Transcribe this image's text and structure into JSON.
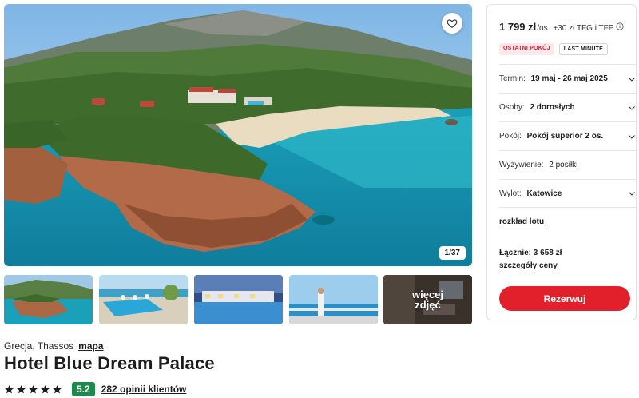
{
  "gallery": {
    "counter": "1/37",
    "favorite_icon": "heart-icon",
    "more_photos_label_line1": "więcej",
    "more_photos_label_line2": "zdjęć"
  },
  "hotel": {
    "location": "Grecja, Thassos",
    "map_link": "mapa",
    "name": "Hotel Blue Dream Palace",
    "stars": 5,
    "rating": "5.2",
    "reviews_link": "282 opinii klientów"
  },
  "booking": {
    "price": "1 799 zł",
    "per_person": "/os.",
    "extra_fees": "+30 zł TFG i TFP",
    "info_icon": "info-icon",
    "badges": [
      "OSTATNI POKÓJ",
      "LAST MINUTE"
    ],
    "rows": [
      {
        "label": "Termin:",
        "value": "19 maj - 26 maj 2025",
        "chevron": true
      },
      {
        "label": "Osoby:",
        "value": "2 dorosłych",
        "chevron": true
      },
      {
        "label": "Pokój:",
        "value": "Pokój superior 2 os.",
        "chevron": true
      },
      {
        "label": "Wyżywienie:",
        "value": "2 posiłki",
        "chevron": false
      },
      {
        "label": "Wylot:",
        "value": "Katowice",
        "chevron": true
      }
    ],
    "flight_schedule_link": "rozkład lotu",
    "total": "Łącznie: 3 658 zł",
    "price_details_link": "szczegóły ceny",
    "book_button": "Rezerwuj"
  },
  "colors": {
    "accent_red": "#e2202c",
    "rating_green": "#1b8a4a",
    "badge_red_bg": "#fde7e9",
    "badge_red_text": "#d0213a"
  }
}
